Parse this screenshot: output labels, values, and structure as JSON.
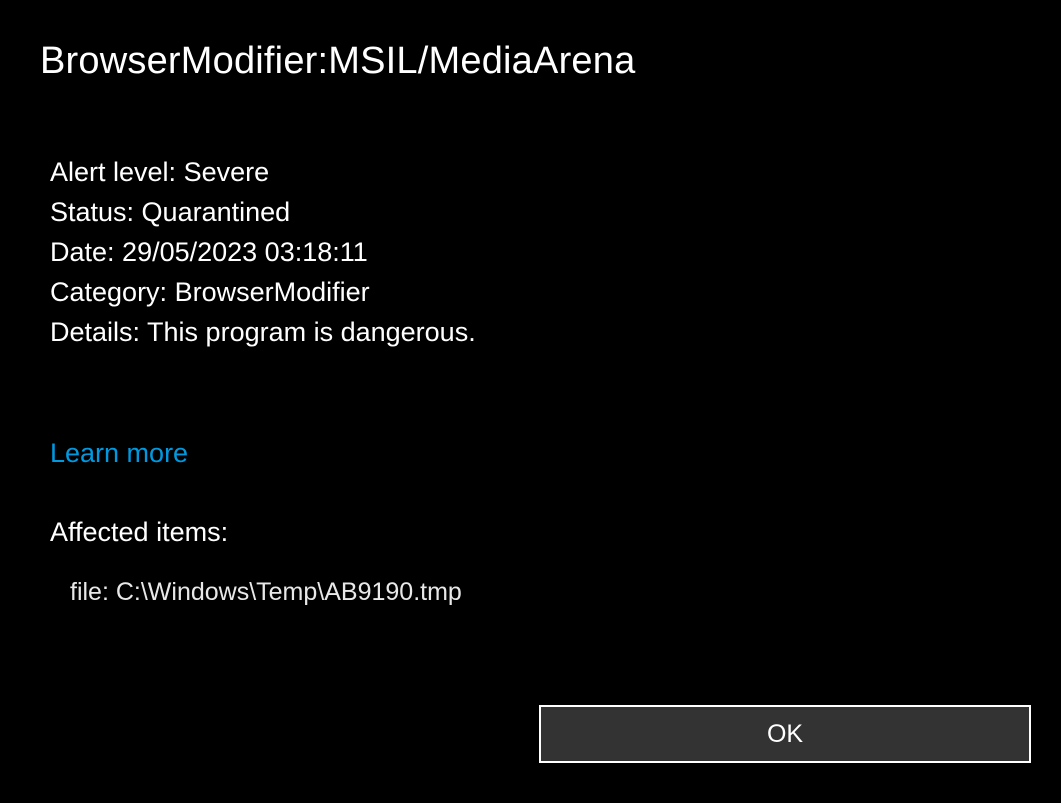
{
  "title": "BrowserModifier:MSIL/MediaArena",
  "info": {
    "alertLevel": {
      "label": "Alert level: ",
      "value": "Severe"
    },
    "status": {
      "label": "Status: ",
      "value": "Quarantined"
    },
    "date": {
      "label": "Date: ",
      "value": " 29/05/2023 03:18:11"
    },
    "category": {
      "label": "Category: ",
      "value": " BrowserModifier"
    },
    "details": {
      "label": "Details: ",
      "value": " This program is dangerous."
    }
  },
  "learnMore": "Learn more",
  "affectedItems": {
    "heading": "Affected items:",
    "item": "file: C:\\Windows\\Temp\\AB9190.tmp"
  },
  "okButton": "OK"
}
